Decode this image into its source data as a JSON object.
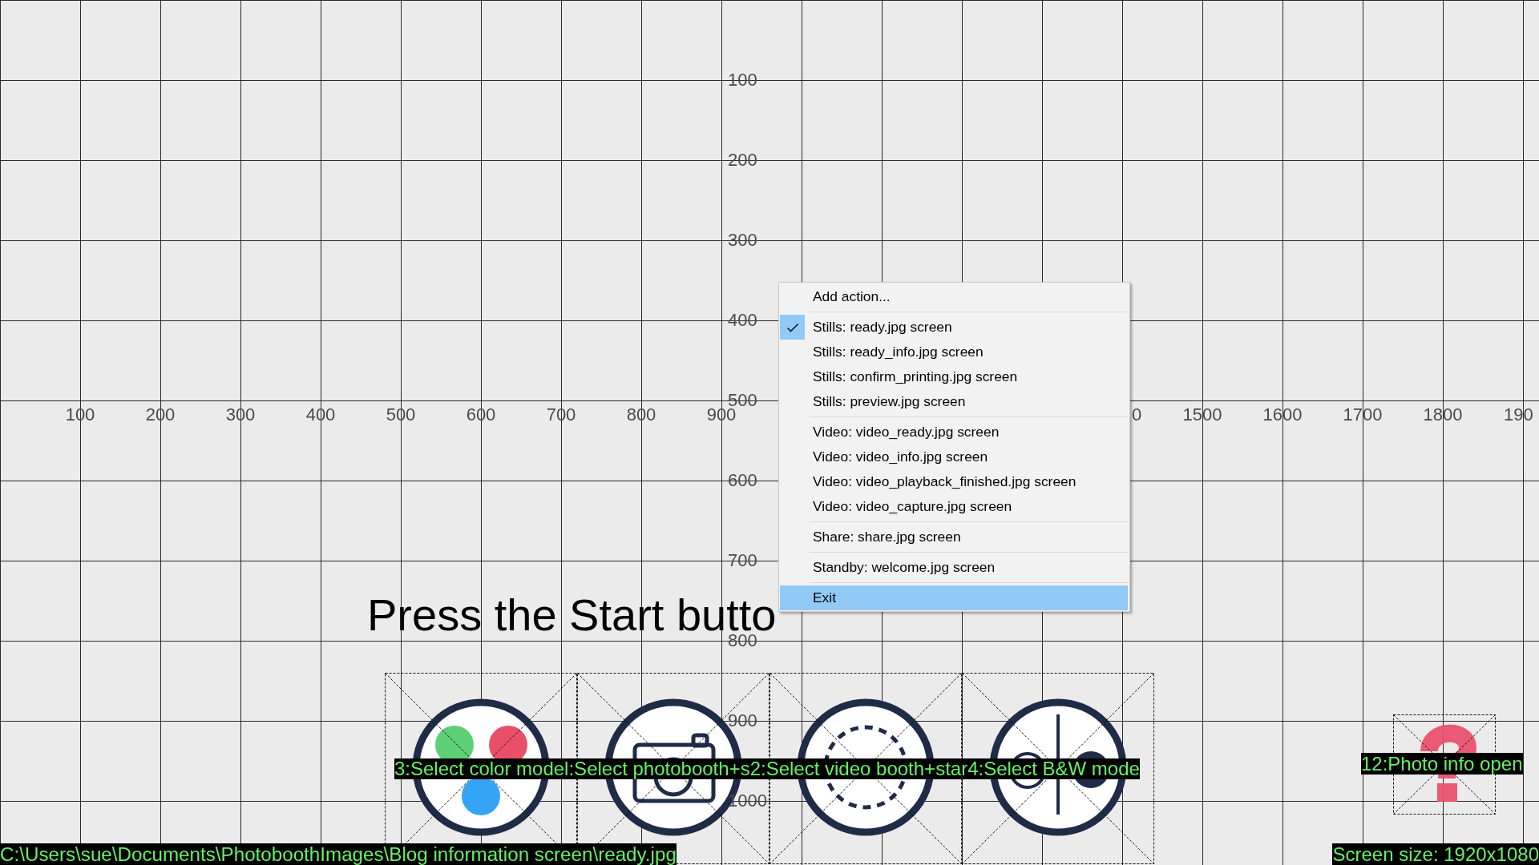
{
  "grid": {
    "y_axis_labels": [
      "100",
      "200",
      "300",
      "400",
      "500",
      "600",
      "700",
      "800",
      "900",
      "1000"
    ],
    "x_axis_labels": [
      "100",
      "200",
      "300",
      "400",
      "500",
      "600",
      "700",
      "800",
      "900",
      "0",
      "1500",
      "1600",
      "1700",
      "1800",
      "190"
    ]
  },
  "prompt": "Press the Start butto",
  "touch_buttons": [
    {
      "kind": "color_model",
      "label": "3:Select color model"
    },
    {
      "kind": "photobooth",
      "label": ":Select photobooth+s"
    },
    {
      "kind": "video_booth",
      "label": "2:Select video booth+star"
    },
    {
      "kind": "bw_mode",
      "label": "4:Select B&W mode"
    }
  ],
  "info_button": {
    "label": "12:Photo info open"
  },
  "status": {
    "file_path": "C:\\Users\\sue\\Documents\\PhotoboothImages\\Blog information screen\\ready.jpg",
    "screen_size": "Screen size: 1920x1080"
  },
  "context_menu": {
    "groups": [
      {
        "items": [
          {
            "label": "Add action...",
            "checked": false,
            "selected": false
          }
        ]
      },
      {
        "items": [
          {
            "label": "Stills: ready.jpg screen",
            "checked": true,
            "selected": false
          },
          {
            "label": "Stills: ready_info.jpg screen",
            "checked": false,
            "selected": false
          },
          {
            "label": "Stills: confirm_printing.jpg screen",
            "checked": false,
            "selected": false
          },
          {
            "label": "Stills: preview.jpg screen",
            "checked": false,
            "selected": false
          }
        ]
      },
      {
        "items": [
          {
            "label": "Video: video_ready.jpg screen",
            "checked": false,
            "selected": false
          },
          {
            "label": "Video: video_info.jpg screen",
            "checked": false,
            "selected": false
          },
          {
            "label": "Video: video_playback_finished.jpg screen",
            "checked": false,
            "selected": false
          },
          {
            "label": "Video: video_capture.jpg screen",
            "checked": false,
            "selected": false
          }
        ]
      },
      {
        "items": [
          {
            "label": "Share: share.jpg screen",
            "checked": false,
            "selected": false
          }
        ]
      },
      {
        "items": [
          {
            "label": "Standby: welcome.jpg screen",
            "checked": false,
            "selected": false
          }
        ]
      },
      {
        "items": [
          {
            "label": "Exit",
            "checked": false,
            "selected": true
          }
        ]
      }
    ]
  }
}
